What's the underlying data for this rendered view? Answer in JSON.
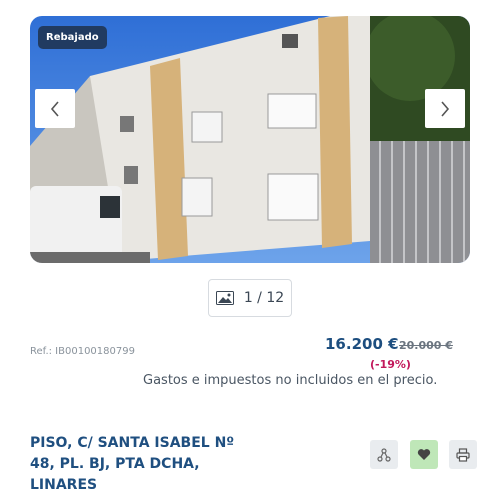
{
  "listing": {
    "badge": "Rebajado",
    "gallery_counter": "1 / 12",
    "reference": "Ref.: IB00100180799",
    "price": "16.200 €",
    "old_price": "20.000 €",
    "discount": "(-19%)",
    "taxes_note": "Gastos e impuestos no incluidos en el precio.",
    "title_lines": [
      "PISO, C/ SANTA ISABEL Nº",
      "48, PL. BJ, PTA DCHA,",
      "LINARES"
    ]
  },
  "icons": {
    "prev": "chevron-left-icon",
    "next": "chevron-right-icon",
    "gallery": "image-icon",
    "share": "share-icon",
    "favorite": "heart-icon",
    "print": "printer-icon"
  },
  "colors": {
    "badge_bg": "#213b61",
    "price": "#1d4e7f",
    "discount": "#c2185b",
    "favorite_bg": "#bfe7b8"
  }
}
